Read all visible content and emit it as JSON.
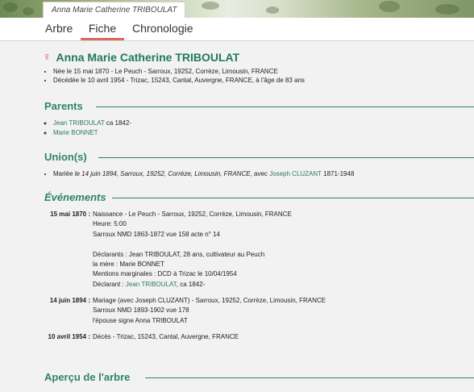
{
  "header": {
    "banner_title": "Anna Marie Catherine TRIBOULAT"
  },
  "tabs": [
    {
      "label": "Arbre",
      "active": false
    },
    {
      "label": "Fiche",
      "active": true
    },
    {
      "label": "Chronologie",
      "active": false
    }
  ],
  "person": {
    "sex_icon": "female-icon",
    "name": "Anna Marie Catherine TRIBOULAT",
    "birth": "Née le 15 mai 1870 - Le Peuch - Sarroux, 19252, Corrèze, Limousin, FRANCE",
    "death": "Décédée le 10 avril 1954 - Trizac, 15243, Cantal, Auvergne, FRANCE, à l'âge de 83 ans"
  },
  "parents": {
    "heading": "Parents",
    "items": [
      {
        "name": "Jean TRIBOULAT",
        "suffix": " ca 1842-"
      },
      {
        "name": "Marie BONNET",
        "suffix": ""
      }
    ]
  },
  "unions": {
    "heading": "Union(s)",
    "prefix": "Mariée ",
    "detail": "le 14 juin 1894, Sarroux, 19252, Corrèze, Limousin, FRANCE,",
    "avec": " avec ",
    "spouse": "Joseph CLUZANT",
    "spouse_dates": " 1871-1948"
  },
  "events": {
    "heading": "Événements",
    "list": [
      {
        "date": "15 mai 1870 :",
        "lines": [
          "Naissance - Le Peuch - Sarroux, 19252, Corrèze, Limousin, FRANCE",
          "Heure: 5:00",
          "Sarroux NMD 1863-1872 vue 158 acte n° 14",
          "",
          "Déclarants : Jean TRIBOULAT, 28 ans, cultivateur au Peuch",
          "la mère : Marie BONNET",
          "Mentions marginales : DCD à Trizac le 10/04/1954"
        ],
        "declarant_prefix": "Déclarant : ",
        "declarant_link": "Jean TRIBOULAT",
        "declarant_suffix": ", ca 1842-"
      },
      {
        "date": "14 juin 1894 :",
        "lines": [
          "Mariage (avec Joseph CLUZANT) - Sarroux, 19252, Corrèze, Limousin, FRANCE",
          "Sarroux NMD 1893-1902 vue 178",
          "l'épouse signe Anna TRIBOULAT"
        ]
      },
      {
        "date": "10 avril 1954 :",
        "lines": [
          "Décès - Trizac, 15243, Cantal, Auvergne, FRANCE"
        ]
      }
    ]
  },
  "tree_preview": {
    "heading": "Aperçu de l'arbre"
  },
  "colors": {
    "accent_green": "#2e8467",
    "tab_active_underline": "#d96a5f",
    "female_icon": "#c83e8a"
  }
}
